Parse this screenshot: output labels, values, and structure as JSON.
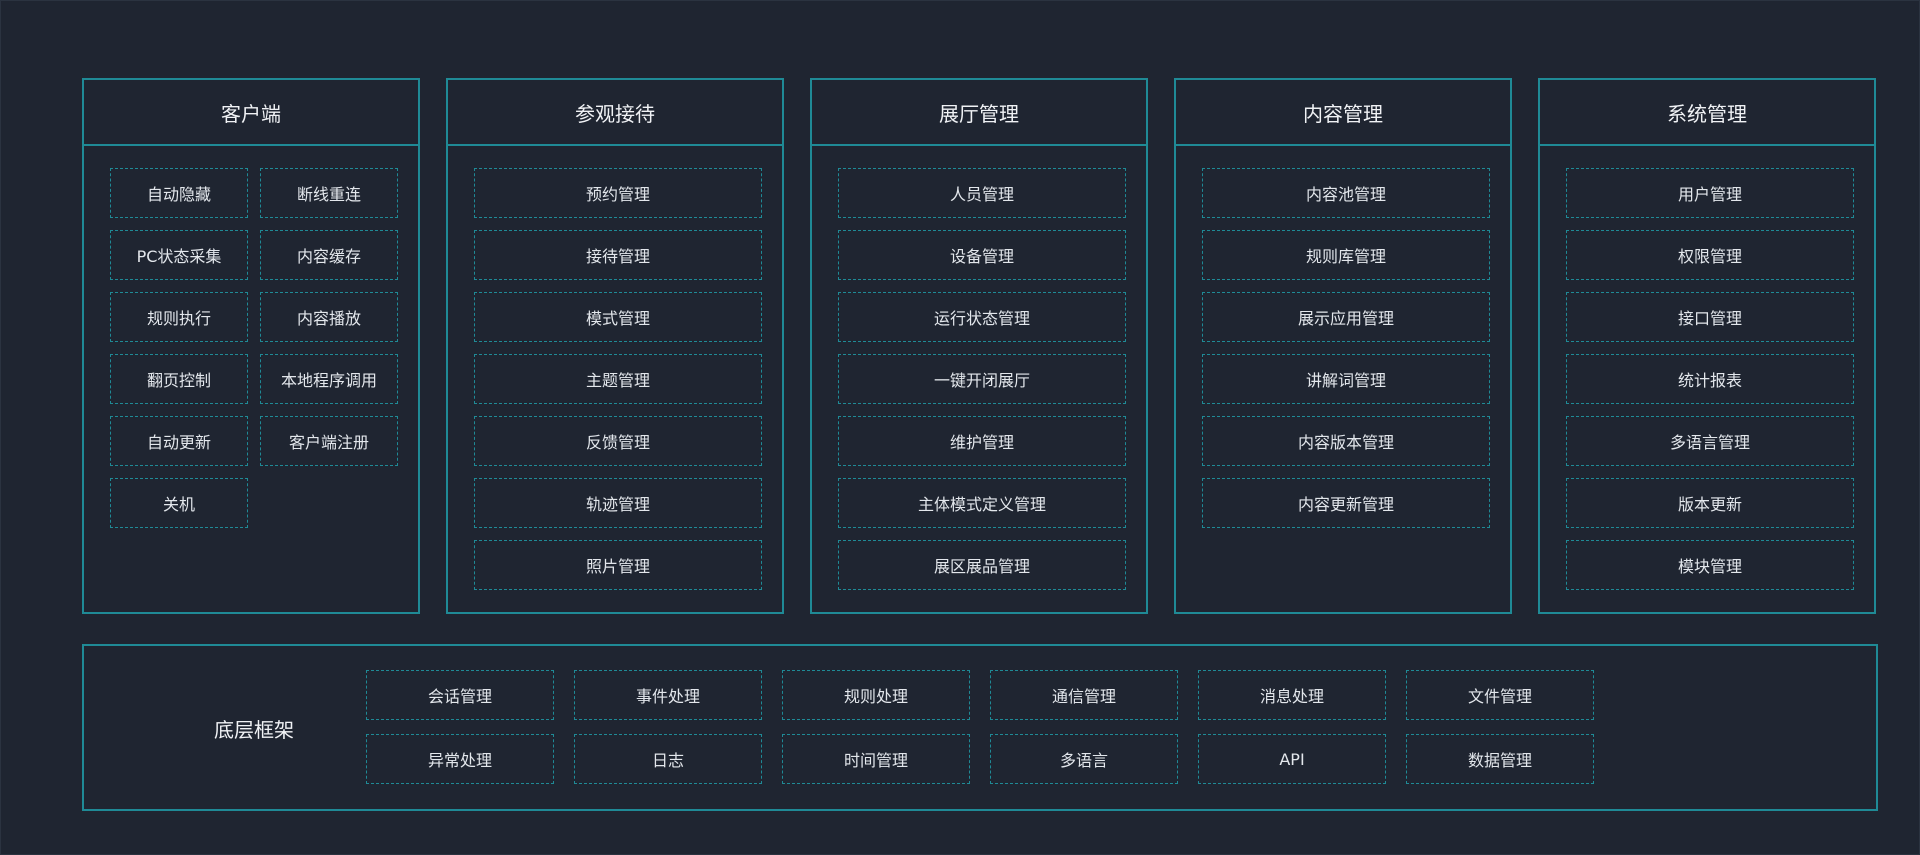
{
  "panels": [
    {
      "title": "客户端",
      "items": [
        "自动隐藏",
        "断线重连",
        "PC状态采集",
        "内容缓存",
        "规则执行",
        "内容播放",
        "翻页控制",
        "本地程序调用",
        "自动更新",
        "客户端注册",
        "关机"
      ]
    },
    {
      "title": "参观接待",
      "items": [
        "预约管理",
        "接待管理",
        "模式管理",
        "主题管理",
        "反馈管理",
        "轨迹管理",
        "照片管理"
      ]
    },
    {
      "title": "展厅管理",
      "items": [
        "人员管理",
        "设备管理",
        "运行状态管理",
        "一键开闭展厅",
        "维护管理",
        "主体模式定义管理",
        "展区展品管理"
      ]
    },
    {
      "title": "内容管理",
      "items": [
        "内容池管理",
        "规则库管理",
        "展示应用管理",
        "讲解词管理",
        "内容版本管理",
        "内容更新管理"
      ]
    },
    {
      "title": "系统管理",
      "items": [
        "用户管理",
        "权限管理",
        "接口管理",
        "统计报表",
        "多语言管理",
        "版本更新",
        "模块管理"
      ]
    }
  ],
  "bottom": {
    "title": "底层框架",
    "items": [
      "会话管理",
      "事件处理",
      "规则处理",
      "通信管理",
      "消息处理",
      "文件管理",
      "异常处理",
      "日志",
      "时间管理",
      "多语言",
      "API",
      "数据管理"
    ]
  }
}
